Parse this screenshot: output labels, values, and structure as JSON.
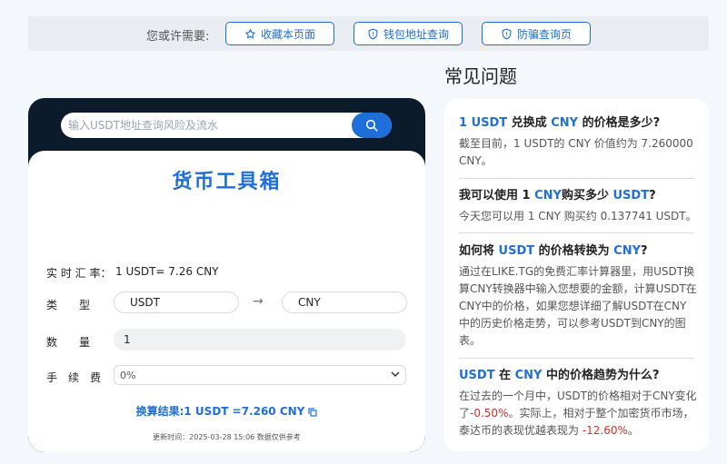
{
  "topbar": {
    "prompt": "您或许需要:",
    "buttons": [
      {
        "label": "收藏本页面",
        "icon": "star-icon"
      },
      {
        "label": "钱包地址查询",
        "icon": "shield-icon"
      },
      {
        "label": "防骗查询页",
        "icon": "shield-icon"
      }
    ]
  },
  "search": {
    "placeholder": "输入USDT地址查询风险及流水",
    "icon": "search-icon"
  },
  "converter": {
    "title": "货币工具箱",
    "rate_label": "实 时 汇 率：",
    "rate_value": "1 USDT= 7.26 CNY",
    "type_label": "类　　型",
    "from_currency": "USDT",
    "to_currency": "CNY",
    "arrow": "→",
    "amount_label": "数　　量",
    "amount_value": "1",
    "fee_label": "手　续　费",
    "fee_value": "0%",
    "result": "换算结果:1 USDT =7.260 CNY",
    "update_time": "更新时间：2025-03-28 15:06  数据仅供参考"
  },
  "faq": {
    "title": "常见问题",
    "items": [
      {
        "q_parts": [
          "1 USDT",
          " 兑换成 ",
          "CNY",
          " 的价格是多少?"
        ],
        "answer": "截至目前，1 USDT的 CNY 价值约为 7.260000 CNY。"
      },
      {
        "q_parts": [
          "我可以使用 1 ",
          "CNY",
          "购买多少 ",
          "USDT",
          "?"
        ],
        "answer": "今天您可以用 1 CNY 购买约 0.137741 USDT。"
      },
      {
        "q_parts": [
          "如何将 ",
          "USDT",
          " 的价格转换为 ",
          "CNY",
          "?"
        ],
        "answer": "通过在LIKE.TG的免费汇率计算器里，用USDT换算CNY转换器中输入您想要的金额，计算USDT在CNY中的价格，如果您想详细了解USDT在CNY中的历史价格走势，可以参考USDT到CNY的图表。"
      },
      {
        "q_parts": [
          "USDT",
          " 在 ",
          "CNY",
          " 中的价格趋势为什么?"
        ],
        "answer_parts": [
          "在过去的一个月中，USDT的价格相对于CNY变化了",
          "-0.50%",
          "。实际上，相对于整个加密货币市场，泰达币的表现优越表现为 ",
          "-12.60%",
          "。"
        ]
      }
    ]
  },
  "colors": {
    "accent": "#1e6fd9",
    "dark": "#0b1b2b",
    "negative": "#d93025"
  }
}
